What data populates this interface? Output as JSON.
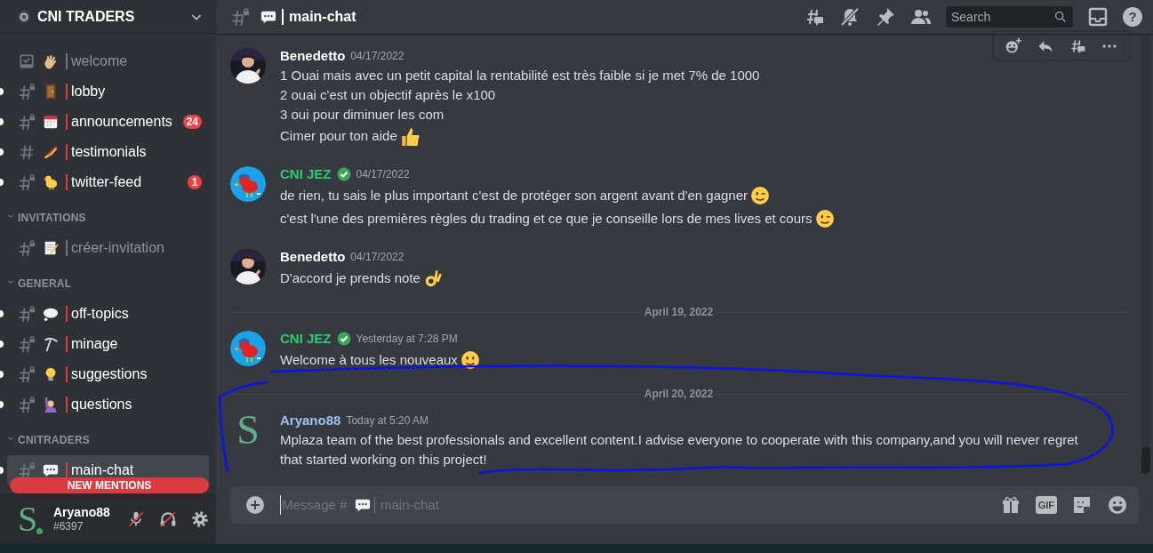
{
  "server": {
    "name": "CNI TRADERS"
  },
  "sidebar": {
    "sections": [
      {
        "channels": [
          {
            "name": "welcome",
            "kind": "wave",
            "unread": false,
            "selected": false
          },
          {
            "name": "lobby",
            "kind": "door",
            "unread": true,
            "selected": false
          },
          {
            "name": "announcements",
            "kind": "calendar",
            "unread": true,
            "selected": false,
            "badge": "24"
          },
          {
            "name": "testimonials",
            "kind": "writing",
            "unread": true,
            "selected": false
          },
          {
            "name": "twitter-feed",
            "kind": "chick",
            "unread": true,
            "selected": false,
            "badge": "1"
          }
        ]
      },
      {
        "title": "INVITATIONS",
        "channels": [
          {
            "name": "créer-invitation",
            "kind": "memo",
            "unread": false,
            "selected": false
          }
        ]
      },
      {
        "title": "GENERAL",
        "channels": [
          {
            "name": "off-topics",
            "kind": "thought",
            "unread": true,
            "selected": false
          },
          {
            "name": "minage",
            "kind": "pick",
            "unread": true,
            "selected": false
          },
          {
            "name": "suggestions",
            "kind": "bulb",
            "unread": true,
            "selected": false
          },
          {
            "name": "questions",
            "kind": "raise",
            "unread": true,
            "selected": false
          }
        ]
      },
      {
        "title": "CNITRADERS",
        "channels": [
          {
            "name": "main-chat",
            "kind": "speech",
            "unread": true,
            "selected": true
          }
        ]
      }
    ]
  },
  "new_mentions": "NEW MENTIONS",
  "user": {
    "avatar_letter": "S",
    "name": "Aryano88",
    "tag": "#6397",
    "mic_muted": true,
    "deafened": true
  },
  "chat": {
    "channel": "main-chat",
    "search": {
      "placeholder": "Search"
    },
    "help": "?",
    "feed": [
      {
        "kind": "photo-message",
        "author": "Benedetto",
        "color": "#ffffff",
        "verified": false,
        "time": "04/17/2022",
        "lines": [
          {
            "text": "1 Ouai mais avec un petit capital la rentabilité est très faible si je met 7% de 1000",
            "kind": "plain"
          },
          {
            "text": "2 ouai c'est un objectif après le x100",
            "kind": "plain"
          },
          {
            "text": "3 oui pour diminuer les com",
            "kind": "plain"
          },
          {
            "text": "Cimer pour ton aide",
            "kind": "thumbs"
          }
        ]
      },
      {
        "kind": "bird-message",
        "author": "CNI JEZ",
        "color": "#2ecc71",
        "verified": true,
        "time": "04/17/2022",
        "lines": [
          {
            "text": "de rien, tu sais le plus important c'est de protéger son argent avant d'en gagner",
            "kind": "wink"
          },
          {
            "text": "c'est l'une des premières règles du trading et ce que je conseille lors de mes lives et cours",
            "kind": "wink"
          }
        ]
      },
      {
        "kind": "photo-message",
        "author": "Benedetto",
        "color": "#ffffff",
        "verified": false,
        "time": "04/17/2022",
        "lines": [
          {
            "text": "D'accord je prends note",
            "kind": "ok"
          }
        ]
      },
      {
        "kind": "divider",
        "label": "April 19, 2022"
      },
      {
        "kind": "bird-message",
        "author": "CNI JEZ",
        "color": "#2ecc71",
        "verified": true,
        "time": "Yesterday at 7:28 PM",
        "lines": [
          {
            "text": "Welcome à tous les nouveaux",
            "kind": "smile"
          }
        ]
      },
      {
        "kind": "divider",
        "label": "April 20, 2022"
      },
      {
        "kind": "letter-message",
        "author": "Aryano88",
        "color": "#9cc3f5",
        "verified": false,
        "avatar_letter": "S",
        "time": "Today at 5:20 AM",
        "lines": [
          {
            "text": "Mplaza team of the best professionals and excellent content.I advise everyone to cooperate with this company,and you will never regret that started working on this project!",
            "kind": "plain"
          }
        ]
      }
    ],
    "composer": {
      "placeholder": "Message #",
      "channel": "main-chat",
      "gif": "GIF"
    }
  }
}
